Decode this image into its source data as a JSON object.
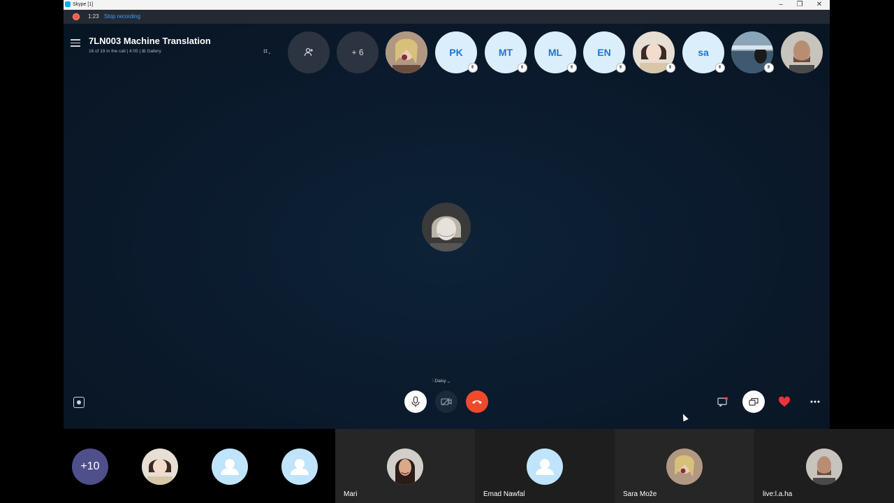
{
  "window": {
    "title": "Skype [1]"
  },
  "recording": {
    "time": "1:23",
    "stop_label": "Stop recording"
  },
  "call": {
    "title": "7LN003 Machine Translation",
    "subtitle": "16 of 19 in the call | 4:05 | ⊞ Gallery",
    "more_participants": "+ 6",
    "device_label": "⫶ Daisy ⌄"
  },
  "participants_header": [
    {
      "type": "photo",
      "name": "photo-1"
    },
    {
      "type": "initials",
      "label": "PK"
    },
    {
      "type": "initials",
      "label": "MT"
    },
    {
      "type": "initials",
      "label": "ML"
    },
    {
      "type": "initials",
      "label": "EN"
    },
    {
      "type": "photo",
      "name": "photo-2"
    },
    {
      "type": "initials",
      "label": "sa"
    },
    {
      "type": "photo",
      "name": "photo-3"
    },
    {
      "type": "photo",
      "name": "photo-4"
    }
  ],
  "gallery": {
    "overflow_count": "+10",
    "tiles": [
      {
        "name": "Mari"
      },
      {
        "name": "Emad Nawfal"
      },
      {
        "name": "Sara Može"
      },
      {
        "name": "live:l.a.ha"
      }
    ]
  },
  "colors": {
    "accent": "#00aff0",
    "hangup": "#f04a2a",
    "heart": "#f0323a",
    "initials_text": "#1a76d2"
  },
  "icons": [
    "hamburger-icon",
    "layout-icon",
    "add-person-icon",
    "mic-icon",
    "camera-off-icon",
    "hangup-icon",
    "chat-icon",
    "share-screen-icon",
    "heart-icon",
    "more-icon",
    "focus-icon"
  ]
}
